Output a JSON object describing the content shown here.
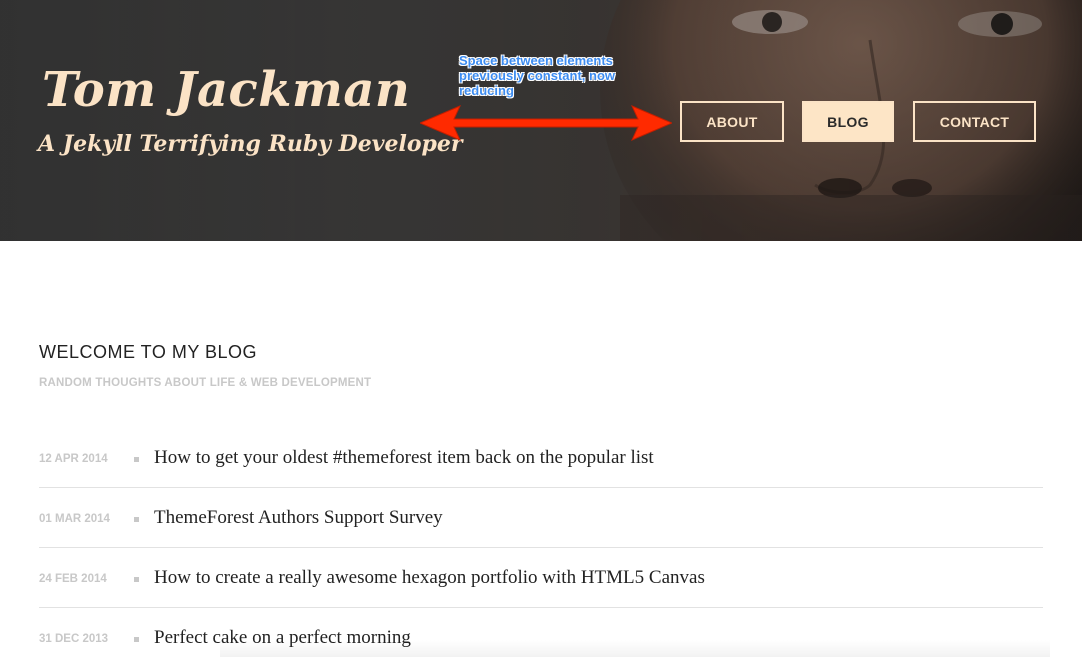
{
  "header": {
    "title": "Tom Jackman",
    "subtitle": "A Jekyll Terrifying Ruby Developer"
  },
  "annotation": {
    "text": "Space between elements previously constant, now reducing",
    "color": "#3d8cf0",
    "arrow_color": "#ff2a00"
  },
  "nav": {
    "about": "ABOUT",
    "blog": "BLOG",
    "contact": "CONTACT",
    "active": "blog",
    "accent": "#fde5c6"
  },
  "main": {
    "title": "WELCOME TO MY BLOG",
    "subtitle": "RANDOM THOUGHTS ABOUT LIFE & WEB DEVELOPMENT",
    "posts": [
      {
        "date": "12 APR 2014",
        "title": "How to get your oldest #themeforest item back on the popular list"
      },
      {
        "date": "01 MAR 2014",
        "title": "ThemeForest Authors Support Survey"
      },
      {
        "date": "24 FEB 2014",
        "title": "How to create a really awesome hexagon portfolio with HTML5 Canvas"
      },
      {
        "date": "31 DEC 2013",
        "title": "Perfect cake on a perfect morning"
      }
    ]
  }
}
